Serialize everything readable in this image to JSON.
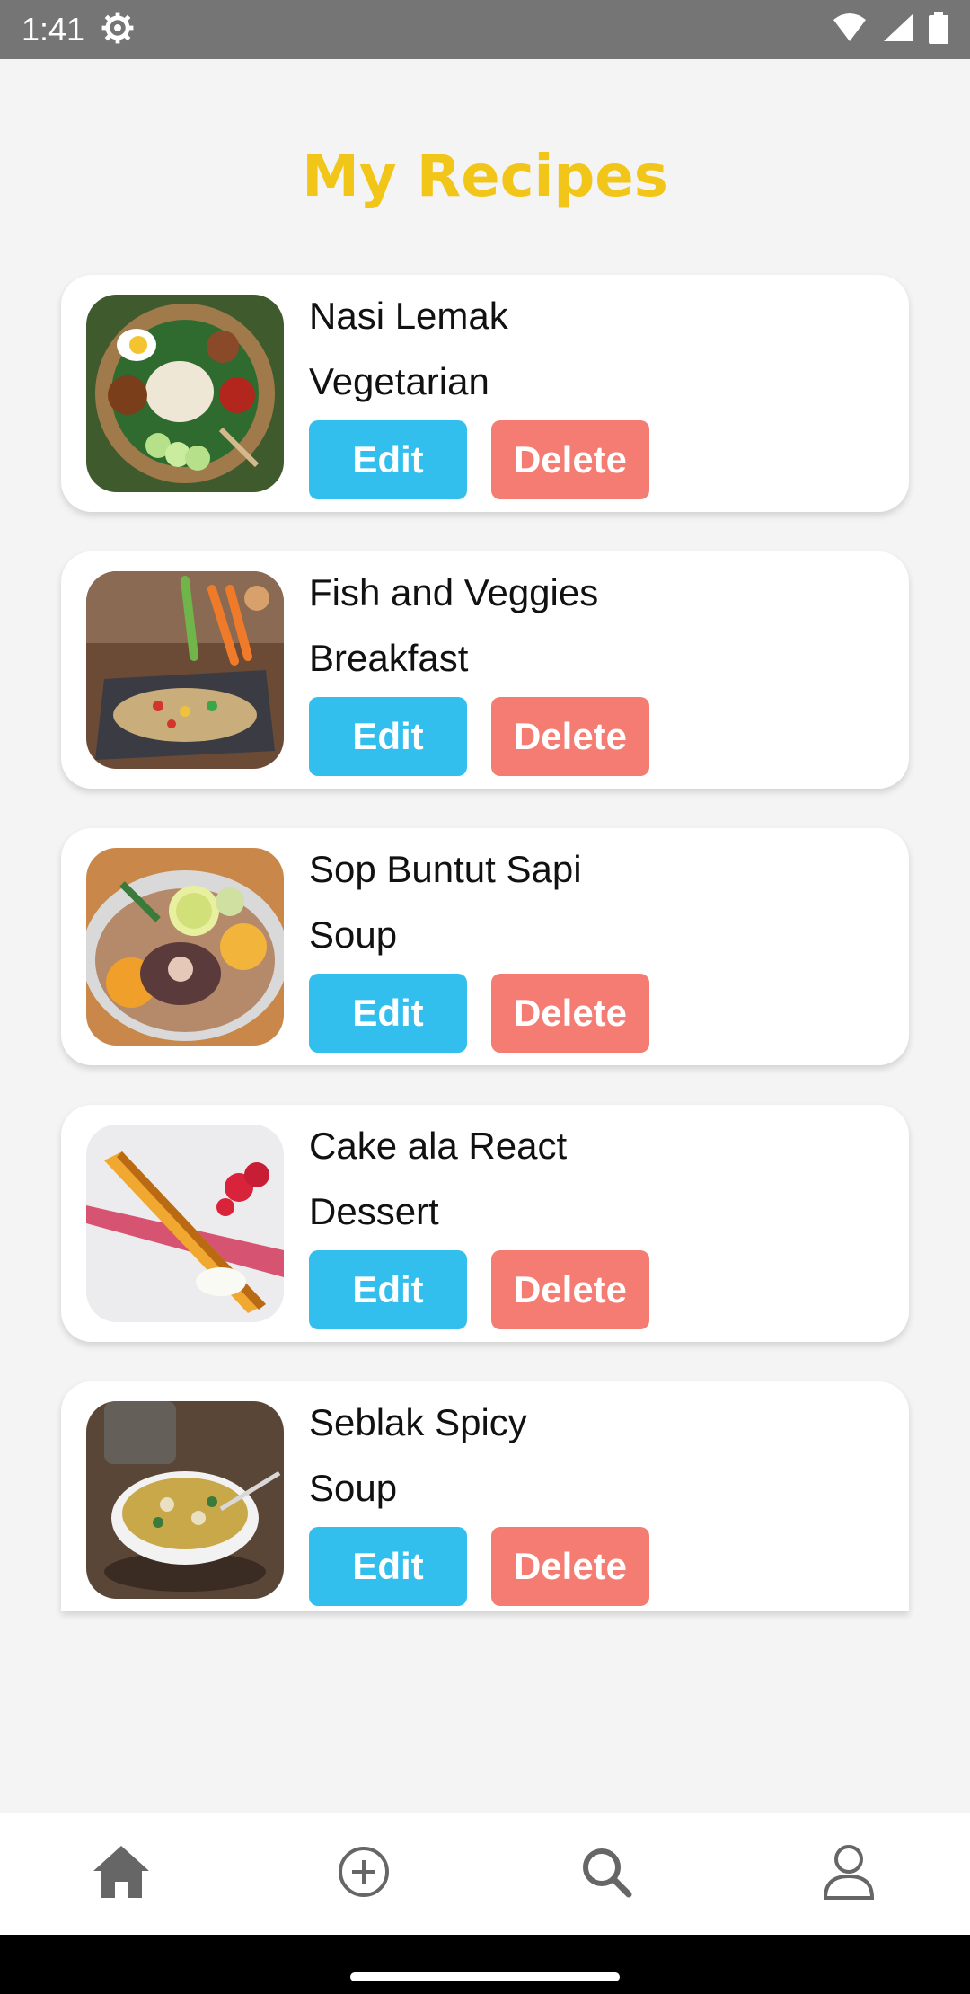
{
  "status_bar": {
    "time": "1:41",
    "icons": [
      "gear-icon",
      "wifi-icon",
      "signal-icon",
      "battery-icon"
    ]
  },
  "page": {
    "title": "My Recipes"
  },
  "colors": {
    "title": "#f2c619",
    "edit_button": "#33bfee",
    "delete_button": "#f57c72",
    "nav_icon": "#666666"
  },
  "recipes": [
    {
      "name": "Nasi Lemak",
      "category": "Vegetarian",
      "edit_label": "Edit",
      "delete_label": "Delete"
    },
    {
      "name": "Fish and Veggies",
      "category": "Breakfast",
      "edit_label": "Edit",
      "delete_label": "Delete"
    },
    {
      "name": "Sop Buntut Sapi",
      "category": "Soup",
      "edit_label": "Edit",
      "delete_label": "Delete"
    },
    {
      "name": "Cake ala React",
      "category": "Dessert",
      "edit_label": "Edit",
      "delete_label": "Delete"
    },
    {
      "name": "Seblak Spicy",
      "category": "Soup",
      "edit_label": "Edit",
      "delete_label": "Delete"
    }
  ],
  "bottom_nav": {
    "items": [
      "home-icon",
      "add-icon",
      "search-icon",
      "profile-icon"
    ]
  }
}
